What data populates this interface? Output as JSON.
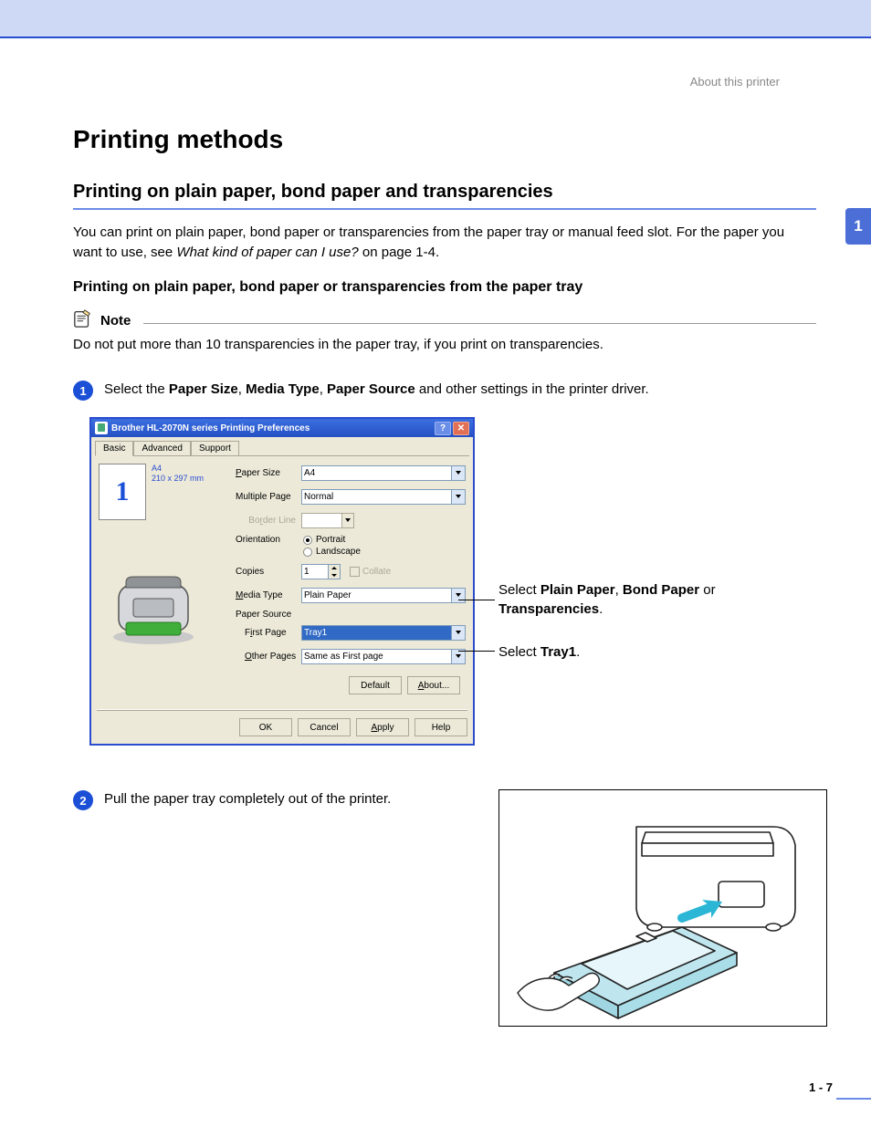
{
  "header": {
    "breadcrumb": "About this printer"
  },
  "sideTab": "1",
  "h1": "Printing methods",
  "h2": "Printing on plain paper, bond paper and transparencies",
  "intro": {
    "pre": "You can print on plain paper, bond paper or transparencies from the paper tray or manual feed slot. For the paper you want to use, see ",
    "linkText": "What kind of paper can I use?",
    "post": " on page 1-4."
  },
  "h3": "Printing on plain paper, bond paper or transparencies from the paper tray",
  "note": {
    "label": "Note",
    "text": "Do not put more than 10 transparencies in the paper tray, if you print on transparencies."
  },
  "step1": {
    "num": "1",
    "pre": "Select the ",
    "b1": "Paper Size",
    "s1": ", ",
    "b2": "Media Type",
    "s2": ", ",
    "b3": "Paper Source",
    "post": " and other settings in the printer driver."
  },
  "dialog": {
    "title": "Brother HL-2070N series Printing Preferences",
    "tabs": {
      "basic": "Basic",
      "advanced": "Advanced",
      "support": "Support"
    },
    "preview": {
      "num": "1",
      "meta1": "A4",
      "meta2": "210 x 297 mm"
    },
    "labels": {
      "paperSize": "Paper Size",
      "multiplePage": "Multiple Page",
      "borderLine": "Border Line",
      "orientation": "Orientation",
      "copies": "Copies",
      "collate": "Collate",
      "mediaType": "Media Type",
      "paperSource": "Paper Source",
      "firstPage": "First Page",
      "otherPages": "Other Pages"
    },
    "values": {
      "paperSize": "A4",
      "multiplePage": "Normal",
      "portrait": "Portrait",
      "landscape": "Landscape",
      "copies": "1",
      "mediaType": "Plain Paper",
      "firstPage": "Tray1",
      "otherPages": "Same as First page"
    },
    "buttons": {
      "default": "Default",
      "about": "About...",
      "ok": "OK",
      "cancel": "Cancel",
      "apply": "Apply",
      "help": "Help"
    }
  },
  "annot1": {
    "pre": "Select ",
    "b1": "Plain Paper",
    "s1": ", ",
    "b2": "Bond Paper",
    "s2": " or ",
    "b3": "Transparencies",
    "post": "."
  },
  "annot2": {
    "pre": "Select ",
    "b1": "Tray1",
    "post": "."
  },
  "step2": {
    "num": "2",
    "text": "Pull the paper tray completely out of the printer."
  },
  "pageNum": "1 - 7"
}
